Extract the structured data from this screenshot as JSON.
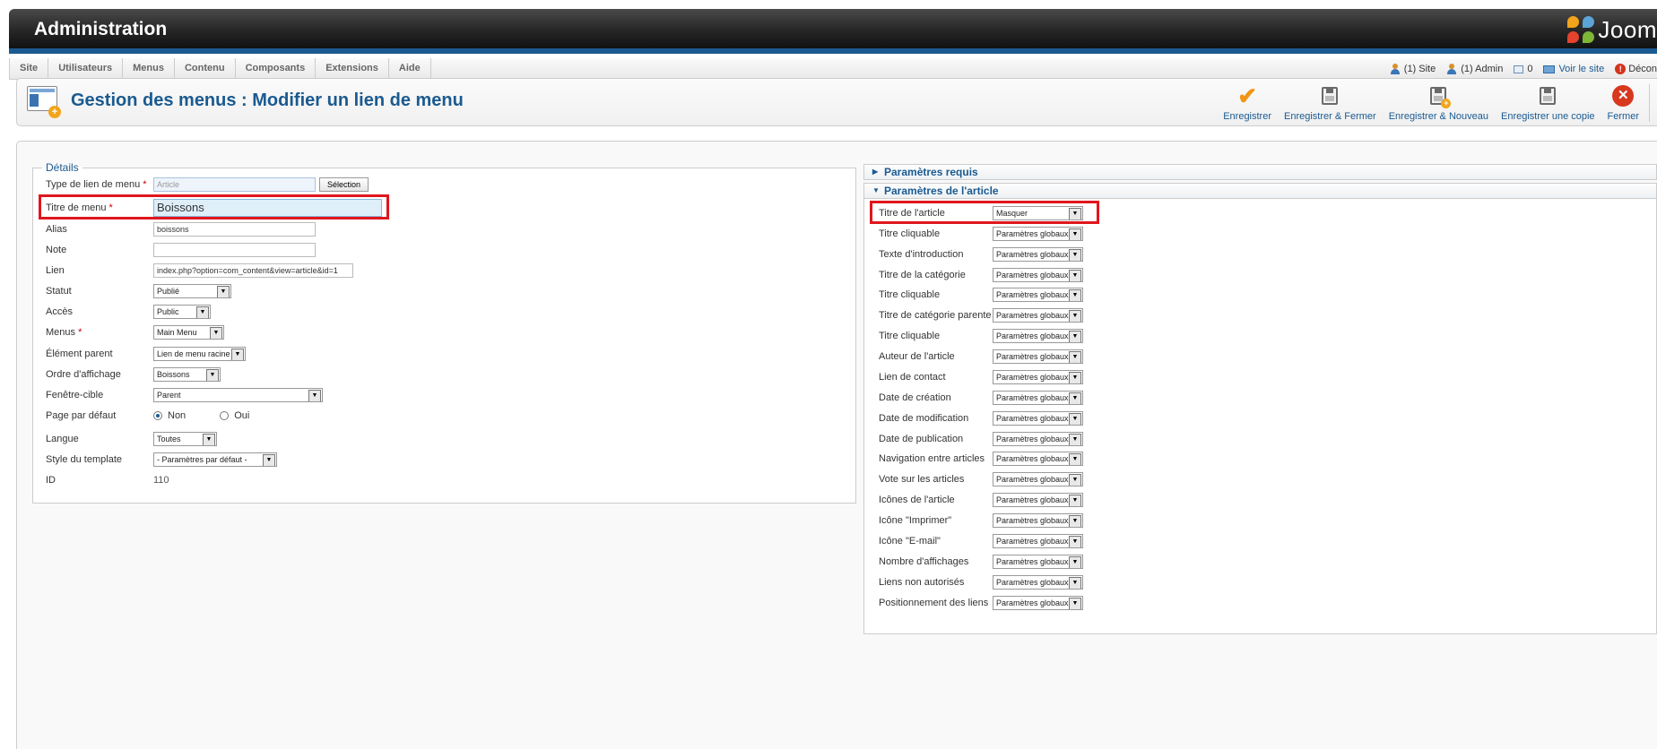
{
  "header": {
    "title": "Administration",
    "logo_text": "Joom"
  },
  "menu": {
    "items": [
      "Site",
      "Utilisateurs",
      "Menus",
      "Contenu",
      "Composants",
      "Extensions",
      "Aide"
    ],
    "status": {
      "site": "(1) Site",
      "admin": "(1) Admin",
      "messages": "0",
      "view_site": "Voir le site",
      "logout": "Décon"
    }
  },
  "toolbar": {
    "title": "Gestion des menus : Modifier un lien de menu",
    "buttons": {
      "save": "Enregistrer",
      "save_close": "Enregistrer & Fermer",
      "save_new": "Enregistrer & Nouveau",
      "save_copy": "Enregistrer une copie",
      "close": "Fermer"
    }
  },
  "details": {
    "legend": "Détails",
    "type_label": "Type de lien de menu",
    "type_value": "Article",
    "select_button": "Sélection",
    "title_label": "Titre de menu",
    "title_value": "Boissons",
    "alias_label": "Alias",
    "alias_value": "boissons",
    "note_label": "Note",
    "note_value": "",
    "link_label": "Lien",
    "link_value": "index.php?option=com_content&view=article&id=1",
    "status_label": "Statut",
    "status_value": "Publié",
    "access_label": "Accès",
    "access_value": "Public",
    "menus_label": "Menus",
    "menus_value": "Main Menu",
    "parent_label": "Élément parent",
    "parent_value": "Lien de menu racine",
    "order_label": "Ordre d'affichage",
    "order_value": "Boissons",
    "target_label": "Fenêtre-cible",
    "target_value": "Parent",
    "default_label": "Page par défaut",
    "default_no": "Non",
    "default_yes": "Oui",
    "lang_label": "Langue",
    "lang_value": "Toutes",
    "style_label": "Style du template",
    "style_value": "- Paramètres par défaut -",
    "id_label": "ID",
    "id_value": "110",
    "required_mark": "*"
  },
  "params": {
    "required_title": "Paramètres requis",
    "article_title": "Paramètres de l'article",
    "rows": [
      {
        "label": "Titre de l'article",
        "value": "Masquer"
      },
      {
        "label": "Titre cliquable",
        "value": "Paramètres globaux"
      },
      {
        "label": "Texte d'introduction",
        "value": "Paramètres globaux"
      },
      {
        "label": "Titre de la catégorie",
        "value": "Paramètres globaux"
      },
      {
        "label": "Titre cliquable",
        "value": "Paramètres globaux"
      },
      {
        "label": "Titre de catégorie parente",
        "value": "Paramètres globaux"
      },
      {
        "label": "Titre cliquable",
        "value": "Paramètres globaux"
      },
      {
        "label": "Auteur de l'article",
        "value": "Paramètres globaux"
      },
      {
        "label": "Lien de contact",
        "value": "Paramètres globaux"
      },
      {
        "label": "Date de création",
        "value": "Paramètres globaux"
      },
      {
        "label": "Date de modification",
        "value": "Paramètres globaux"
      },
      {
        "label": "Date de publication",
        "value": "Paramètres globaux"
      },
      {
        "label": "Navigation entre articles",
        "value": "Paramètres globaux"
      },
      {
        "label": "Vote sur les articles",
        "value": "Paramètres globaux"
      },
      {
        "label": "Icônes de l'article",
        "value": "Paramètres globaux"
      },
      {
        "label": "Icône \"Imprimer\"",
        "value": "Paramètres globaux"
      },
      {
        "label": "Icône \"E-mail\"",
        "value": "Paramètres globaux"
      },
      {
        "label": "Nombre d'affichages",
        "value": "Paramètres globaux"
      },
      {
        "label": "Liens non autorisés",
        "value": "Paramètres globaux"
      },
      {
        "label": "Positionnement des liens",
        "value": "Paramètres globaux"
      }
    ]
  },
  "colors": {
    "accent": "#1a5a90",
    "highlight": "#e0161e"
  }
}
